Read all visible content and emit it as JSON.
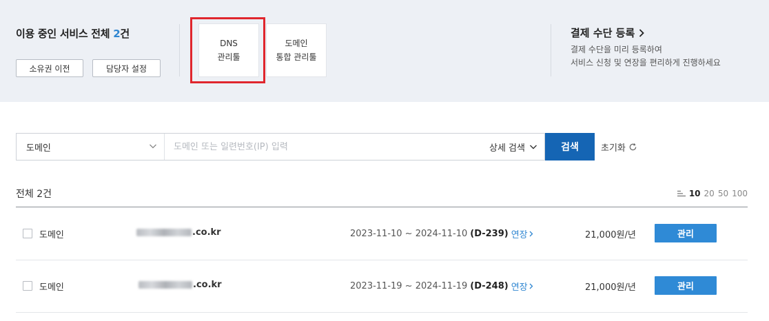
{
  "summary": {
    "title_prefix": "이용 중인 서비스 전체 ",
    "count": "2",
    "title_suffix": "건",
    "transfer_label": "소유권 이전",
    "manager_label": "담당자 설정"
  },
  "tools": [
    {
      "line1": "DNS",
      "line2": "관리툴"
    },
    {
      "line1": "도메인",
      "line2": "통합 관리툴"
    }
  ],
  "payment": {
    "title": "결제 수단 등록",
    "desc1": "결제 수단을 미리 등록하여",
    "desc2": "서비스 신청 및 연장을 편리하게 진행하세요"
  },
  "search": {
    "select_value": "도메인",
    "placeholder": "도메인 또는 일련번호(IP) 입력",
    "detail_label": "상세 검색",
    "button_label": "검색",
    "reset_label": "초기화"
  },
  "list": {
    "total_label": "전체 2건",
    "page_sizes": [
      "10",
      "20",
      "50",
      "100"
    ],
    "active_page_size": "10",
    "rows": [
      {
        "type": "도메인",
        "domain_suffix": ".co.kr",
        "period": "2023-11-10 ~ 2024-11-10",
        "dday": "(D-239)",
        "extend_label": "연장",
        "price": "21,000원/년",
        "manage_label": "관리"
      },
      {
        "type": "도메인",
        "domain_suffix": ".co.kr",
        "period": "2023-11-19 ~ 2024-11-19",
        "dday": "(D-248)",
        "extend_label": "연장",
        "price": "21,000원/년",
        "manage_label": "관리"
      }
    ]
  },
  "colors": {
    "accent": "#2f86d1",
    "search_button": "#1565b4",
    "manage_button": "#2f8ad6",
    "highlight": "#e0262d",
    "panel_bg": "#edf0f5"
  }
}
